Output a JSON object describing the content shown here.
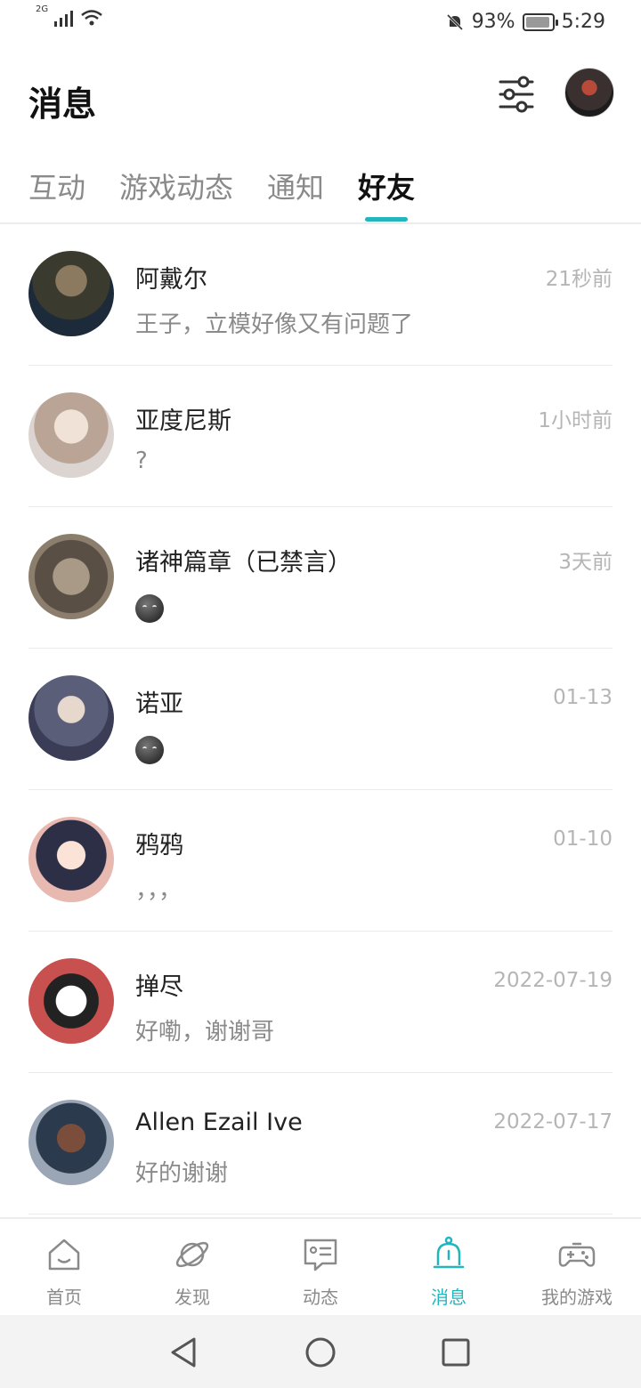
{
  "status_bar": {
    "network": "2G",
    "battery": "93%",
    "time": "5:29",
    "battery_level": 0.93
  },
  "header": {
    "title": "消息",
    "filter_icon": "filter-sliders-icon"
  },
  "tabs": [
    {
      "label": "互动",
      "active": false
    },
    {
      "label": "游戏动态",
      "active": false
    },
    {
      "label": "通知",
      "active": false
    },
    {
      "label": "好友",
      "active": true
    }
  ],
  "conversations": [
    {
      "name": "阿戴尔",
      "time": "21秒前",
      "message": "王子，立模好像又有问题了"
    },
    {
      "name": "亚度尼斯",
      "time": "1小时前",
      "message": "?"
    },
    {
      "name": "诸神篇章（已禁言）",
      "time": "3天前",
      "message": "",
      "emoji": "smirk-emoji"
    },
    {
      "name": "诺亚",
      "time": "01-13",
      "message": "",
      "emoji": "smirk-emoji"
    },
    {
      "name": "鸦鸦",
      "time": "01-10",
      "message": "，，，"
    },
    {
      "name": "掸尽",
      "time": "2022-07-19",
      "message": "好嘞，谢谢哥"
    },
    {
      "name": "Allen Ezail Ive",
      "time": "2022-07-17",
      "message": "好的谢谢"
    }
  ],
  "bottom_nav": [
    {
      "label": "首页",
      "icon": "home-icon",
      "active": false
    },
    {
      "label": "发现",
      "icon": "planet-icon",
      "active": false
    },
    {
      "label": "动态",
      "icon": "feed-icon",
      "active": false
    },
    {
      "label": "消息",
      "icon": "bell-icon",
      "active": true
    },
    {
      "label": "我的游戏",
      "icon": "gamepad-icon",
      "active": false
    }
  ],
  "colors": {
    "accent": "#23b5bd",
    "muted": "#8a8a8a",
    "time": "#b5b5b5"
  }
}
